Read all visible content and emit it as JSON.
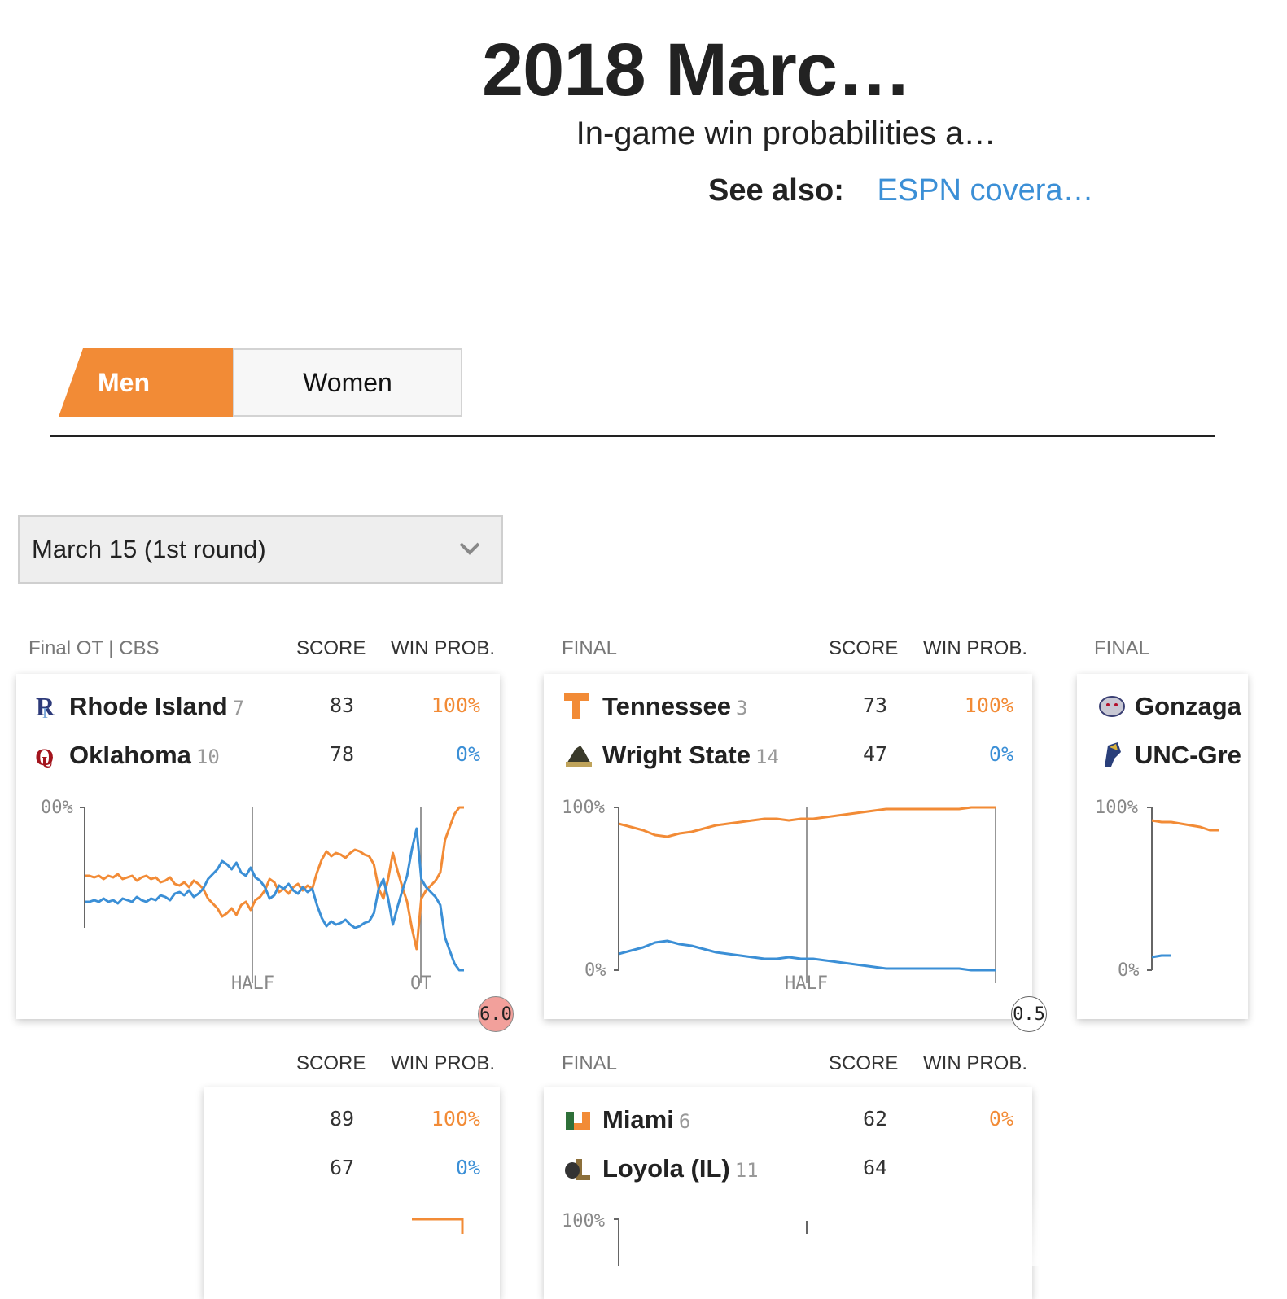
{
  "header": {
    "title": "2018 Marc…",
    "subtitle": "In-game win probabilities a…",
    "see_also_label": "See also:",
    "see_also_link": "ESPN covera…"
  },
  "tabs": [
    {
      "label": "Men",
      "active": true
    },
    {
      "label": "Women",
      "active": false
    }
  ],
  "date_selector": {
    "value": "March 15 (1st round)"
  },
  "colors": {
    "winner": "#f28b36",
    "loser": "#3b8fd6",
    "accent": "#f28b36"
  },
  "column_headers": {
    "score": "SCORE",
    "win_prob": "WIN PROB."
  },
  "games": [
    {
      "status": "Final OT | CBS",
      "teams": [
        {
          "name": "Rhode Island",
          "seed": "7",
          "score": "83",
          "win_prob": "100%",
          "logo": "rhode-island-logo-icon"
        },
        {
          "name": "Oklahoma",
          "seed": "10",
          "score": "78",
          "win_prob": "0%",
          "logo": "oklahoma-logo-icon"
        }
      ],
      "axis": {
        "top": "00%",
        "half": "HALF",
        "ot": "OT"
      },
      "excitement": "6.0",
      "chart_data": {
        "type": "line",
        "ylim": [
          0,
          100
        ],
        "series": [
          {
            "values": [
              58,
              58,
              57,
              58,
              56,
              58,
              57,
              59,
              56,
              57,
              58,
              55,
              57,
              58,
              56,
              57,
              54,
              55,
              57,
              53,
              52,
              54,
              51,
              55,
              53,
              50,
              44,
              41,
              38,
              33,
              35,
              38,
              34,
              40,
              42,
              37,
              43,
              45,
              49,
              56,
              54,
              48,
              50,
              47,
              51,
              53,
              49,
              52,
              50,
              60,
              68,
              73,
              70,
              72,
              71,
              69,
              72,
              74,
              73,
              71,
              70,
              65,
              50,
              44,
              56,
              72,
              61,
              51,
              42,
              26,
              13,
              44,
              49,
              52,
              55,
              60,
              80,
              88,
              96,
              100,
              100
            ]
          },
          {
            "values": [
              42,
              42,
              43,
              42,
              44,
              42,
              43,
              41,
              44,
              43,
              42,
              45,
              43,
              42,
              44,
              43,
              46,
              45,
              43,
              47,
              48,
              46,
              49,
              45,
              47,
              50,
              56,
              59,
              62,
              67,
              65,
              62,
              66,
              60,
              58,
              63,
              57,
              55,
              51,
              44,
              46,
              52,
              50,
              53,
              49,
              47,
              51,
              48,
              50,
              40,
              32,
              27,
              30,
              28,
              29,
              31,
              28,
              26,
              27,
              29,
              30,
              35,
              50,
              56,
              44,
              28,
              39,
              49,
              58,
              74,
              87,
              56,
              51,
              48,
              45,
              40,
              20,
              12,
              4,
              0,
              0
            ]
          }
        ]
      }
    },
    {
      "status": "FINAL",
      "teams": [
        {
          "name": "Tennessee",
          "seed": "3",
          "score": "73",
          "win_prob": "100%",
          "logo": "tennessee-logo-icon"
        },
        {
          "name": "Wright State",
          "seed": "14",
          "score": "47",
          "win_prob": "0%",
          "logo": "wright-state-logo-icon"
        }
      ],
      "axis": {
        "top": "100%",
        "bottom": "0%",
        "half": "HALF"
      },
      "excitement": "0.5",
      "chart_data": {
        "type": "line",
        "ylim": [
          0,
          100
        ],
        "series": [
          {
            "values": [
              90,
              88,
              86,
              83,
              82,
              84,
              85,
              87,
              89,
              90,
              91,
              92,
              93,
              93,
              92,
              93,
              93,
              94,
              95,
              96,
              97,
              98,
              99,
              99,
              99,
              99,
              99,
              99,
              99,
              100,
              100,
              100
            ]
          },
          {
            "values": [
              10,
              12,
              14,
              17,
              18,
              16,
              15,
              13,
              11,
              10,
              9,
              8,
              7,
              7,
              8,
              7,
              7,
              6,
              5,
              4,
              3,
              2,
              1,
              1,
              1,
              1,
              1,
              1,
              1,
              0,
              0,
              0
            ]
          }
        ]
      }
    },
    {
      "status": "FINAL",
      "teams": [
        {
          "name": "Gonzaga",
          "seed": "",
          "score": "",
          "win_prob": "",
          "logo": "gonzaga-logo-icon"
        },
        {
          "name": "UNC-Gre",
          "seed": "",
          "score": "",
          "win_prob": "",
          "logo": "unc-greensboro-logo-icon"
        }
      ],
      "axis": {
        "top": "100%",
        "bottom": "0%"
      },
      "chart_data": {
        "type": "line",
        "ylim": [
          0,
          100
        ],
        "series": [
          {
            "values": [
              92,
              91,
              91,
              90,
              89,
              88,
              86,
              86
            ]
          },
          {
            "values": [
              8,
              9,
              9
            ]
          }
        ]
      }
    },
    {
      "status": "",
      "teams": [
        {
          "name": "",
          "seed": "",
          "score": "89",
          "win_prob": "100%",
          "logo": ""
        },
        {
          "name": "",
          "seed": "",
          "score": "67",
          "win_prob": "0%",
          "logo": ""
        }
      ]
    },
    {
      "status": "FINAL",
      "teams": [
        {
          "name": "Miami",
          "seed": "6",
          "score": "62",
          "win_prob": "0%",
          "logo": "miami-logo-icon"
        },
        {
          "name": "Loyola (IL)",
          "seed": "11",
          "score": "64",
          "win_prob": "",
          "logo": "loyola-logo-icon"
        }
      ],
      "axis": {
        "top": "100%"
      }
    }
  ]
}
